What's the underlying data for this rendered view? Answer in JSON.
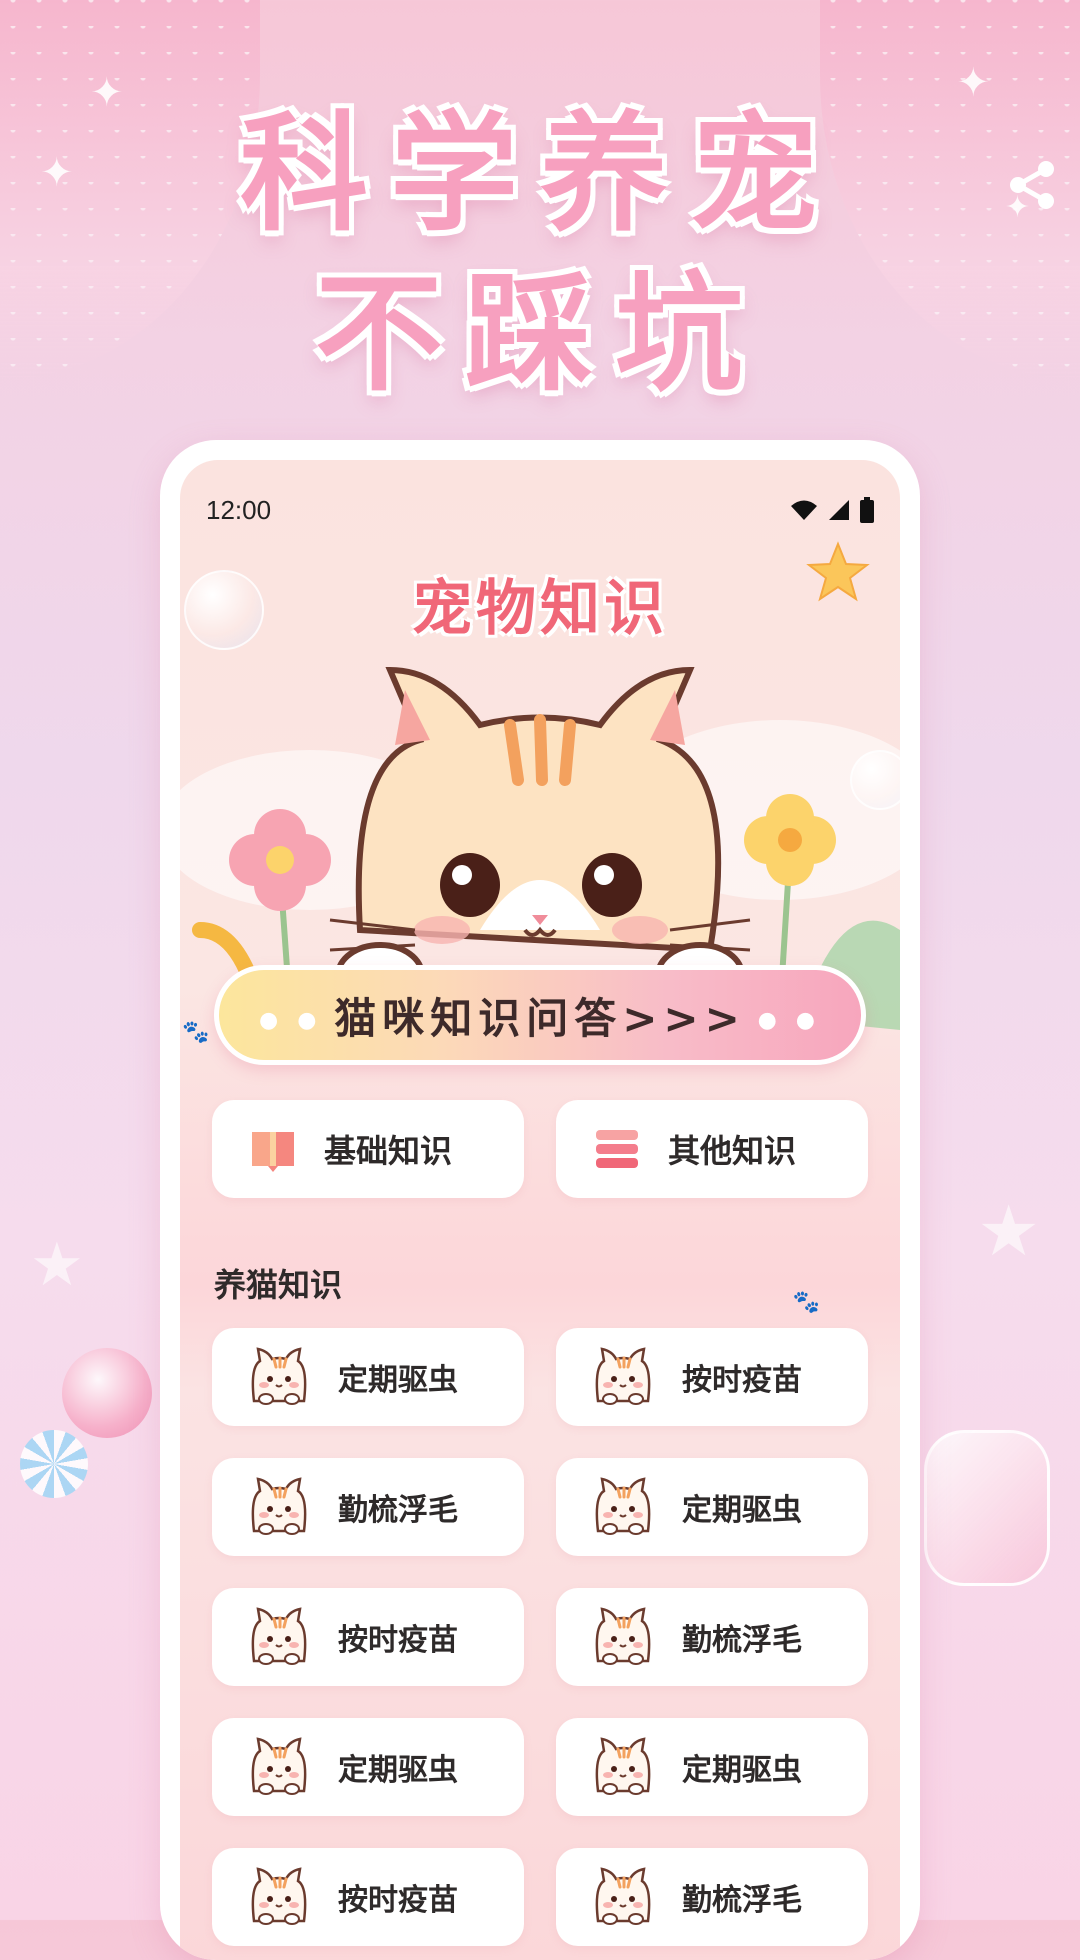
{
  "promo": {
    "headline_1": "科学养宠",
    "headline_2": "不踩坑"
  },
  "status_bar": {
    "time": "12:00"
  },
  "page": {
    "title": "宠物知识"
  },
  "quiz_banner": {
    "label": "猫咪知识问答>>>"
  },
  "categories": [
    {
      "label": "基础知识",
      "icon": "book-icon"
    },
    {
      "label": "其他知识",
      "icon": "stack-icon"
    }
  ],
  "section": {
    "title": "养猫知识"
  },
  "items": [
    {
      "label": "定期驱虫"
    },
    {
      "label": "按时疫苗"
    },
    {
      "label": "勤梳浮毛"
    },
    {
      "label": "定期驱虫"
    },
    {
      "label": "按时疫苗"
    },
    {
      "label": "勤梳浮毛"
    },
    {
      "label": "定期驱虫"
    },
    {
      "label": "定期驱虫"
    },
    {
      "label": "按时疫苗"
    },
    {
      "label": "勤梳浮毛"
    }
  ],
  "colors": {
    "title": "#f06778",
    "headline": "#f7a0bf",
    "banner_start": "#fce69c",
    "banner_end": "#f7a6bd"
  }
}
